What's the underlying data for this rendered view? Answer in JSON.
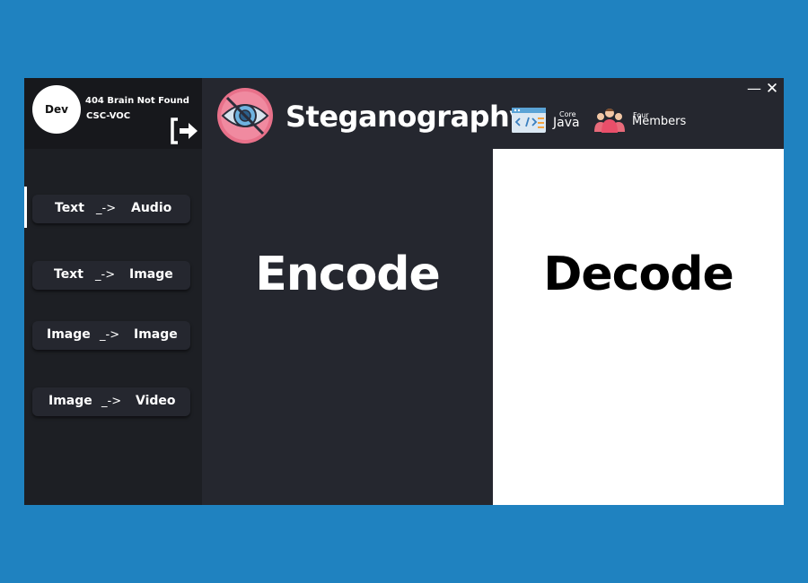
{
  "profile": {
    "avatar_text": "Dev",
    "name": "404 Brain Not Found",
    "team": "CSC-VOC",
    "logout_icon": "logout-icon"
  },
  "sidebar": {
    "items": [
      {
        "from": "Text",
        "arrow": "_->",
        "to": "Audio",
        "active": true
      },
      {
        "from": "Text",
        "arrow": "_->",
        "to": "Image",
        "active": false
      },
      {
        "from": "Image",
        "arrow": "_->",
        "to": "Image",
        "active": false
      },
      {
        "from": "Image",
        "arrow": "_->",
        "to": "Video",
        "active": false
      }
    ]
  },
  "header": {
    "title": "Steganography",
    "logo_icon": "eye-icon",
    "core_small": "Core",
    "core_big": "Java",
    "members_small": "Four",
    "members_big": "Members"
  },
  "window_controls": {
    "minimize": "—",
    "close": "✕"
  },
  "main": {
    "encode_label": "Encode",
    "decode_label": "Decode"
  },
  "colors": {
    "background": "#1f82c0",
    "window": "#25272f",
    "sidebar": "#1d1f24",
    "profile": "#17181c",
    "decode_panel": "#ffffff",
    "logo_pink": "#e8718a"
  }
}
